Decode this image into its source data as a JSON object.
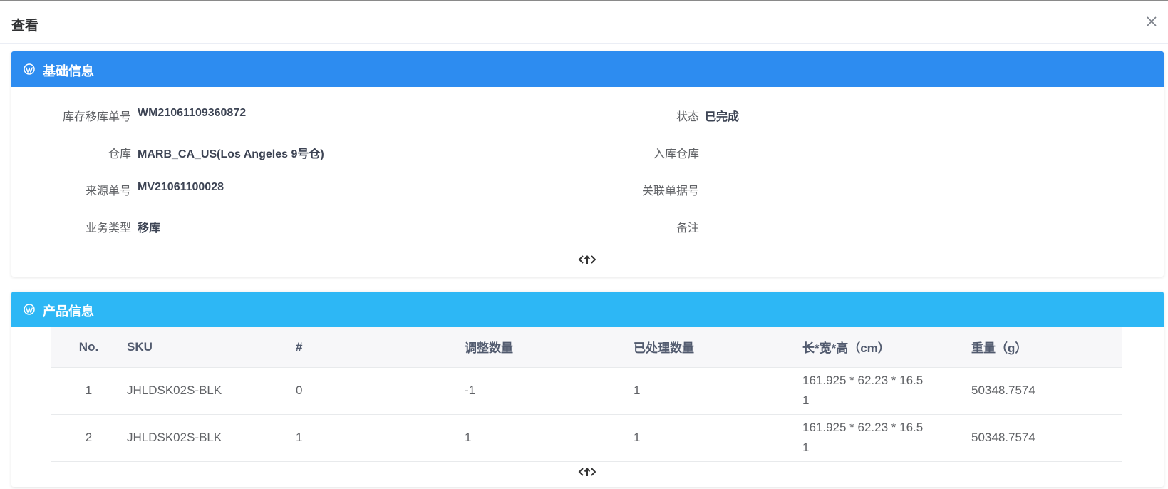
{
  "dialog": {
    "title": "查看"
  },
  "basic": {
    "title": "基础信息",
    "fields": {
      "transfer_no_label": "库存移库单号",
      "transfer_no_value": "WM21061109360872",
      "warehouse_label": "仓库",
      "warehouse_value": "MARB_CA_US(Los Angeles 9号仓)",
      "source_no_label": "来源单号",
      "source_no_value": "MV21061100028",
      "biz_type_label": "业务类型",
      "biz_type_value": "移库",
      "status_label": "状态",
      "status_value": "已完成",
      "inbound_wh_label": "入库仓库",
      "inbound_wh_value": "",
      "related_no_label": "关联单据号",
      "related_no_value": "",
      "remark_label": "备注",
      "remark_value": ""
    }
  },
  "product": {
    "title": "产品信息",
    "columns": [
      "No.",
      "SKU",
      "#",
      "调整数量",
      "已处理数量",
      "长*宽*高（cm）",
      "重量（g）"
    ],
    "rows": [
      {
        "no": "1",
        "sku": "JHLDSK02S-BLK",
        "qty": "0",
        "adjust": "-1",
        "processed": "1",
        "dim_line1": "161.925 * 62.23 * 16.5",
        "dim_line2": "1",
        "weight": "50348.7574"
      },
      {
        "no": "2",
        "sku": "JHLDSK02S-BLK",
        "qty": "1",
        "adjust": "1",
        "processed": "1",
        "dim_line1": "161.925 * 62.23 * 16.5",
        "dim_line2": "1",
        "weight": "50348.7574"
      }
    ]
  },
  "icons": {
    "close": "close-icon",
    "section": "wordpress-icon",
    "collapse": "collapse-arrows-icon"
  },
  "colors": {
    "basic_header": "#2d8cf0",
    "product_header": "#2db7f5"
  }
}
